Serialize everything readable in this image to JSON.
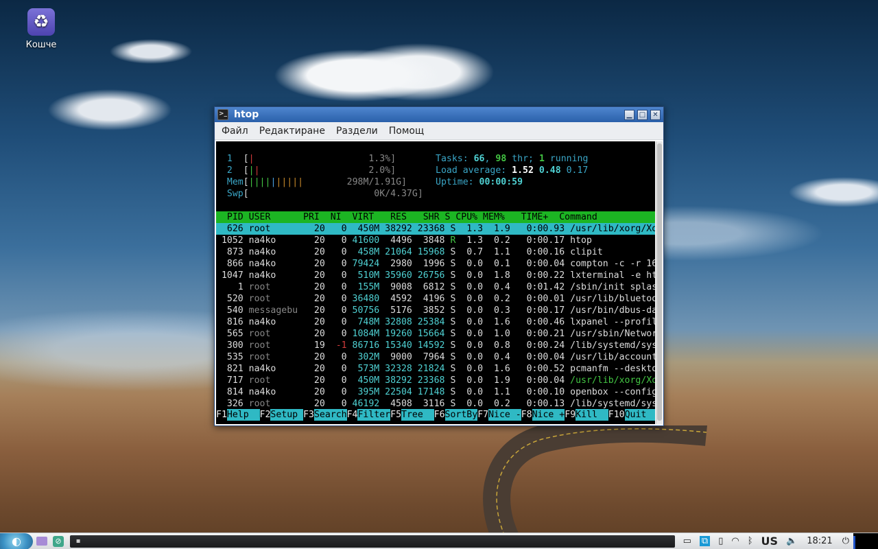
{
  "desktop": {
    "trash_label": "Кошче"
  },
  "window": {
    "title": "htop",
    "menu": [
      "Файл",
      "Редактиране",
      "Раздели",
      "Помощ"
    ]
  },
  "meters": {
    "cpu1": {
      "label": "1",
      "value": "1.3%]"
    },
    "cpu2": {
      "label": "2",
      "value": "2.0%]"
    },
    "mem": {
      "label": "Mem",
      "value": "298M/1.91G]"
    },
    "swp": {
      "label": "Swp",
      "value": "0K/4.37G]"
    }
  },
  "stats": {
    "tasks_label": "Tasks:",
    "tasks": "66",
    "thr": "98",
    "thr_label": "thr;",
    "running": "1",
    "running_label": "running",
    "load_label": "Load average:",
    "load1": "1.52",
    "load5": "0.48",
    "load15": "0.17",
    "uptime_label": "Uptime:",
    "uptime": "00:00:59"
  },
  "columns": "  PID USER      PRI  NI  VIRT   RES   SHR S CPU% MEM%   TIME+  Command",
  "processes": [
    {
      "pid": "626",
      "user": "root",
      "pri": "20",
      "ni": "0",
      "virt": "450M",
      "res": "38292",
      "shr": "23368",
      "s": "S",
      "cpu": "1.3",
      "mem": "1.9",
      "time": "0:00.93",
      "cmd": "/usr/lib/xorg/Xor"
    },
    {
      "pid": "1052",
      "user": "na4ko",
      "pri": "20",
      "ni": "0",
      "virt": "41600",
      "res": "4496",
      "shr": "3848",
      "s": "R",
      "cpu": "1.3",
      "mem": "0.2",
      "time": "0:00.17",
      "cmd": "htop"
    },
    {
      "pid": "873",
      "user": "na4ko",
      "pri": "20",
      "ni": "0",
      "virt": "458M",
      "res": "21064",
      "shr": "15968",
      "s": "S",
      "cpu": "0.7",
      "mem": "1.1",
      "time": "0:00.16",
      "cmd": "clipit"
    },
    {
      "pid": "866",
      "user": "na4ko",
      "pri": "20",
      "ni": "0",
      "virt": "79424",
      "res": "2980",
      "shr": "1996",
      "s": "S",
      "cpu": "0.0",
      "mem": "0.1",
      "time": "0:00.04",
      "cmd": "compton -c -r 16"
    },
    {
      "pid": "1047",
      "user": "na4ko",
      "pri": "20",
      "ni": "0",
      "virt": "510M",
      "res": "35960",
      "shr": "26756",
      "s": "S",
      "cpu": "0.0",
      "mem": "1.8",
      "time": "0:00.22",
      "cmd": "lxterminal -e hto"
    },
    {
      "pid": "1",
      "user": "root",
      "pri": "20",
      "ni": "0",
      "virt": "155M",
      "res": "9008",
      "shr": "6812",
      "s": "S",
      "cpu": "0.0",
      "mem": "0.4",
      "time": "0:01.42",
      "cmd": "/sbin/init splash"
    },
    {
      "pid": "520",
      "user": "root",
      "pri": "20",
      "ni": "0",
      "virt": "36480",
      "res": "4592",
      "shr": "4196",
      "s": "S",
      "cpu": "0.0",
      "mem": "0.2",
      "time": "0:00.01",
      "cmd": "/usr/lib/bluetoot"
    },
    {
      "pid": "540",
      "user": "messagebu",
      "pri": "20",
      "ni": "0",
      "virt": "50756",
      "res": "5176",
      "shr": "3852",
      "s": "S",
      "cpu": "0.0",
      "mem": "0.3",
      "time": "0:00.17",
      "cmd": "/usr/bin/dbus-dae"
    },
    {
      "pid": "816",
      "user": "na4ko",
      "pri": "20",
      "ni": "0",
      "virt": "748M",
      "res": "32808",
      "shr": "25384",
      "s": "S",
      "cpu": "0.0",
      "mem": "1.6",
      "time": "0:00.46",
      "cmd": "lxpanel --profile"
    },
    {
      "pid": "565",
      "user": "root",
      "pri": "20",
      "ni": "0",
      "virt": "1084M",
      "res": "19260",
      "shr": "15664",
      "s": "S",
      "cpu": "0.0",
      "mem": "1.0",
      "time": "0:00.21",
      "cmd": "/usr/sbin/Network"
    },
    {
      "pid": "300",
      "user": "root",
      "pri": "19",
      "ni": "-1",
      "virt": "86716",
      "res": "15340",
      "shr": "14592",
      "s": "S",
      "cpu": "0.0",
      "mem": "0.8",
      "time": "0:00.24",
      "cmd": "/lib/systemd/syst"
    },
    {
      "pid": "535",
      "user": "root",
      "pri": "20",
      "ni": "0",
      "virt": "302M",
      "res": "9000",
      "shr": "7964",
      "s": "S",
      "cpu": "0.0",
      "mem": "0.4",
      "time": "0:00.04",
      "cmd": "/usr/lib/accounts"
    },
    {
      "pid": "821",
      "user": "na4ko",
      "pri": "20",
      "ni": "0",
      "virt": "573M",
      "res": "32328",
      "shr": "21824",
      "s": "S",
      "cpu": "0.0",
      "mem": "1.6",
      "time": "0:00.52",
      "cmd": "pcmanfm --desktop"
    },
    {
      "pid": "717",
      "user": "root",
      "pri": "20",
      "ni": "0",
      "virt": "450M",
      "res": "38292",
      "shr": "23368",
      "s": "S",
      "cpu": "0.0",
      "mem": "1.9",
      "time": "0:00.04",
      "cmd": "/usr/lib/xorg/Xor"
    },
    {
      "pid": "814",
      "user": "na4ko",
      "pri": "20",
      "ni": "0",
      "virt": "395M",
      "res": "22504",
      "shr": "17148",
      "s": "S",
      "cpu": "0.0",
      "mem": "1.1",
      "time": "0:00.10",
      "cmd": "openbox --config-"
    },
    {
      "pid": "326",
      "user": "root",
      "pri": "20",
      "ni": "0",
      "virt": "46192",
      "res": "4508",
      "shr": "3116",
      "s": "S",
      "cpu": "0.0",
      "mem": "0.2",
      "time": "0:00.13",
      "cmd": "/lib/systemd/syst"
    }
  ],
  "fkeys": [
    {
      "key": "F1",
      "label": "Help  "
    },
    {
      "key": "F2",
      "label": "Setup "
    },
    {
      "key": "F3",
      "label": "Search"
    },
    {
      "key": "F4",
      "label": "Filter"
    },
    {
      "key": "F5",
      "label": "Tree  "
    },
    {
      "key": "F6",
      "label": "SortBy"
    },
    {
      "key": "F7",
      "label": "Nice -"
    },
    {
      "key": "F8",
      "label": "Nice +"
    },
    {
      "key": "F9",
      "label": "Kill  "
    },
    {
      "key": "F10",
      "label": "Quit  "
    }
  ],
  "taskbar": {
    "keyboard": "US",
    "clock": "18:21"
  },
  "colors": {
    "header_bg": "#1cb523",
    "selected_bg": "#2fb9c4",
    "title_bar": "#3a73bd"
  }
}
